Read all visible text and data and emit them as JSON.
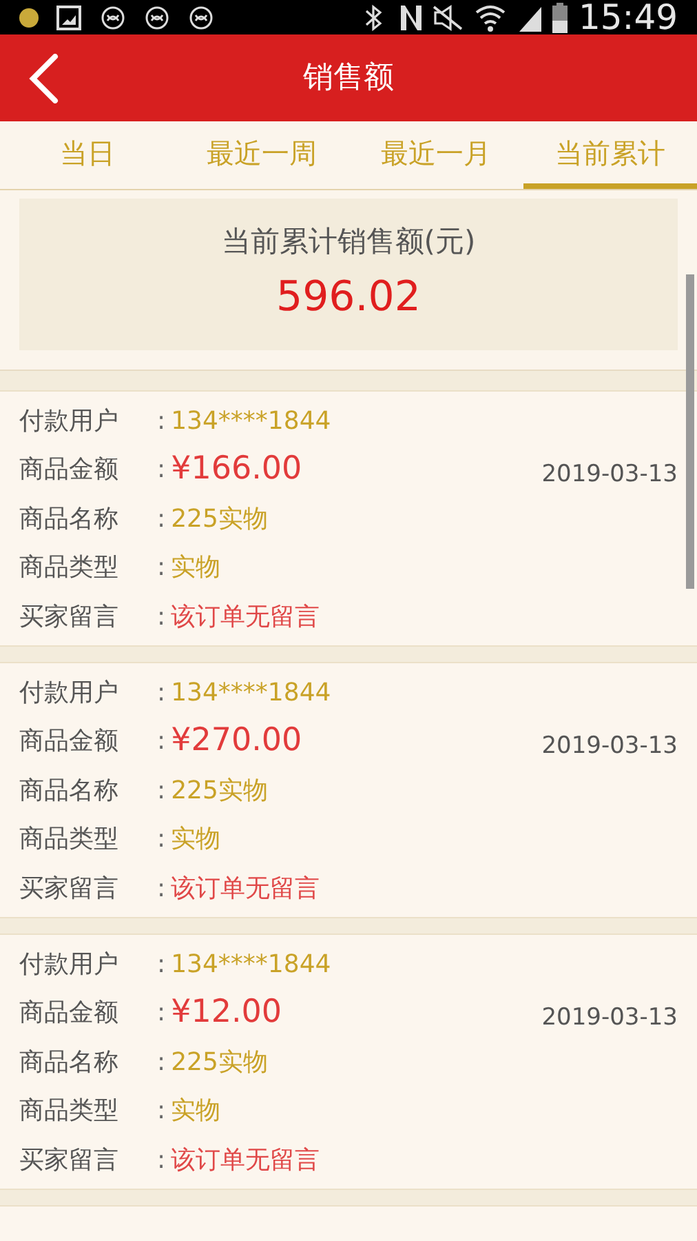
{
  "status_bar": {
    "time": "15:49"
  },
  "header": {
    "title": "销售额"
  },
  "tabs": [
    {
      "label": "当日",
      "selected": false
    },
    {
      "label": "最近一周",
      "selected": false
    },
    {
      "label": "最近一月",
      "selected": false
    },
    {
      "label": "当前累计",
      "selected": true
    }
  ],
  "summary": {
    "label": "当前累计销售额(元)",
    "value": "596.02"
  },
  "orders": [
    {
      "date": "2019-03-13",
      "fields": [
        {
          "kind": "text",
          "label": "付款用户",
          "sep": ":",
          "value": "134****1844"
        },
        {
          "kind": "price",
          "label": "商品金额",
          "sep": ":",
          "value": "¥166.00"
        },
        {
          "kind": "text",
          "label": "商品名称",
          "sep": ":",
          "value": "225实物"
        },
        {
          "kind": "text",
          "label": "商品类型",
          "sep": ":",
          "value": "实物"
        },
        {
          "kind": "note",
          "label": "买家留言",
          "sep": ":",
          "value": "该订单无留言"
        }
      ]
    },
    {
      "date": "2019-03-13",
      "fields": [
        {
          "kind": "text",
          "label": "付款用户",
          "sep": ":",
          "value": "134****1844"
        },
        {
          "kind": "price",
          "label": "商品金额",
          "sep": ":",
          "value": "¥270.00"
        },
        {
          "kind": "text",
          "label": "商品名称",
          "sep": ":",
          "value": "225实物"
        },
        {
          "kind": "text",
          "label": "商品类型",
          "sep": ":",
          "value": "实物"
        },
        {
          "kind": "note",
          "label": "买家留言",
          "sep": ":",
          "value": "该订单无留言"
        }
      ]
    },
    {
      "date": "2019-03-13",
      "fields": [
        {
          "kind": "text",
          "label": "付款用户",
          "sep": ":",
          "value": "134****1844"
        },
        {
          "kind": "price",
          "label": "商品金额",
          "sep": ":",
          "value": "¥12.00"
        },
        {
          "kind": "text",
          "label": "商品名称",
          "sep": ":",
          "value": "225实物"
        },
        {
          "kind": "text",
          "label": "商品类型",
          "sep": ":",
          "value": "实物"
        },
        {
          "kind": "note",
          "label": "买家留言",
          "sep": ":",
          "value": "该订单无留言"
        }
      ]
    }
  ]
}
